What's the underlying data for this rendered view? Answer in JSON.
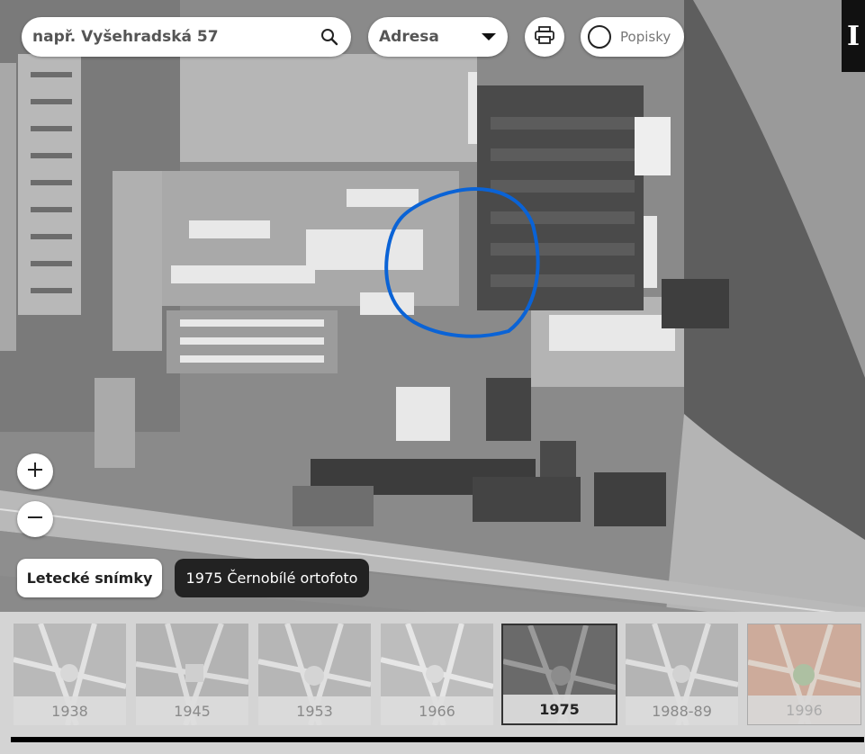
{
  "search": {
    "placeholder": "např. Vyšehradská 57"
  },
  "search_type": {
    "selected": "Adresa"
  },
  "labels_toggle": {
    "label": "Popisky",
    "checked": false
  },
  "info_badge": {
    "text": "I"
  },
  "layer": {
    "button_label": "Letecké snímky",
    "current_label": "1975 Černobílé ortofoto"
  },
  "timeline": {
    "years": [
      {
        "label": "1938",
        "active": false
      },
      {
        "label": "1945",
        "active": false
      },
      {
        "label": "1953",
        "active": false
      },
      {
        "label": "1966",
        "active": false
      },
      {
        "label": "1975",
        "active": true
      },
      {
        "label": "1988-89",
        "active": false
      },
      {
        "label": "1996",
        "active": false
      }
    ]
  },
  "icons": [
    "search-icon",
    "chevron-down-icon",
    "print-icon",
    "plus-icon",
    "minus-icon"
  ],
  "colors": {
    "highlight": "#0a63d6",
    "panel": "#222222",
    "button": "#ffffff"
  }
}
